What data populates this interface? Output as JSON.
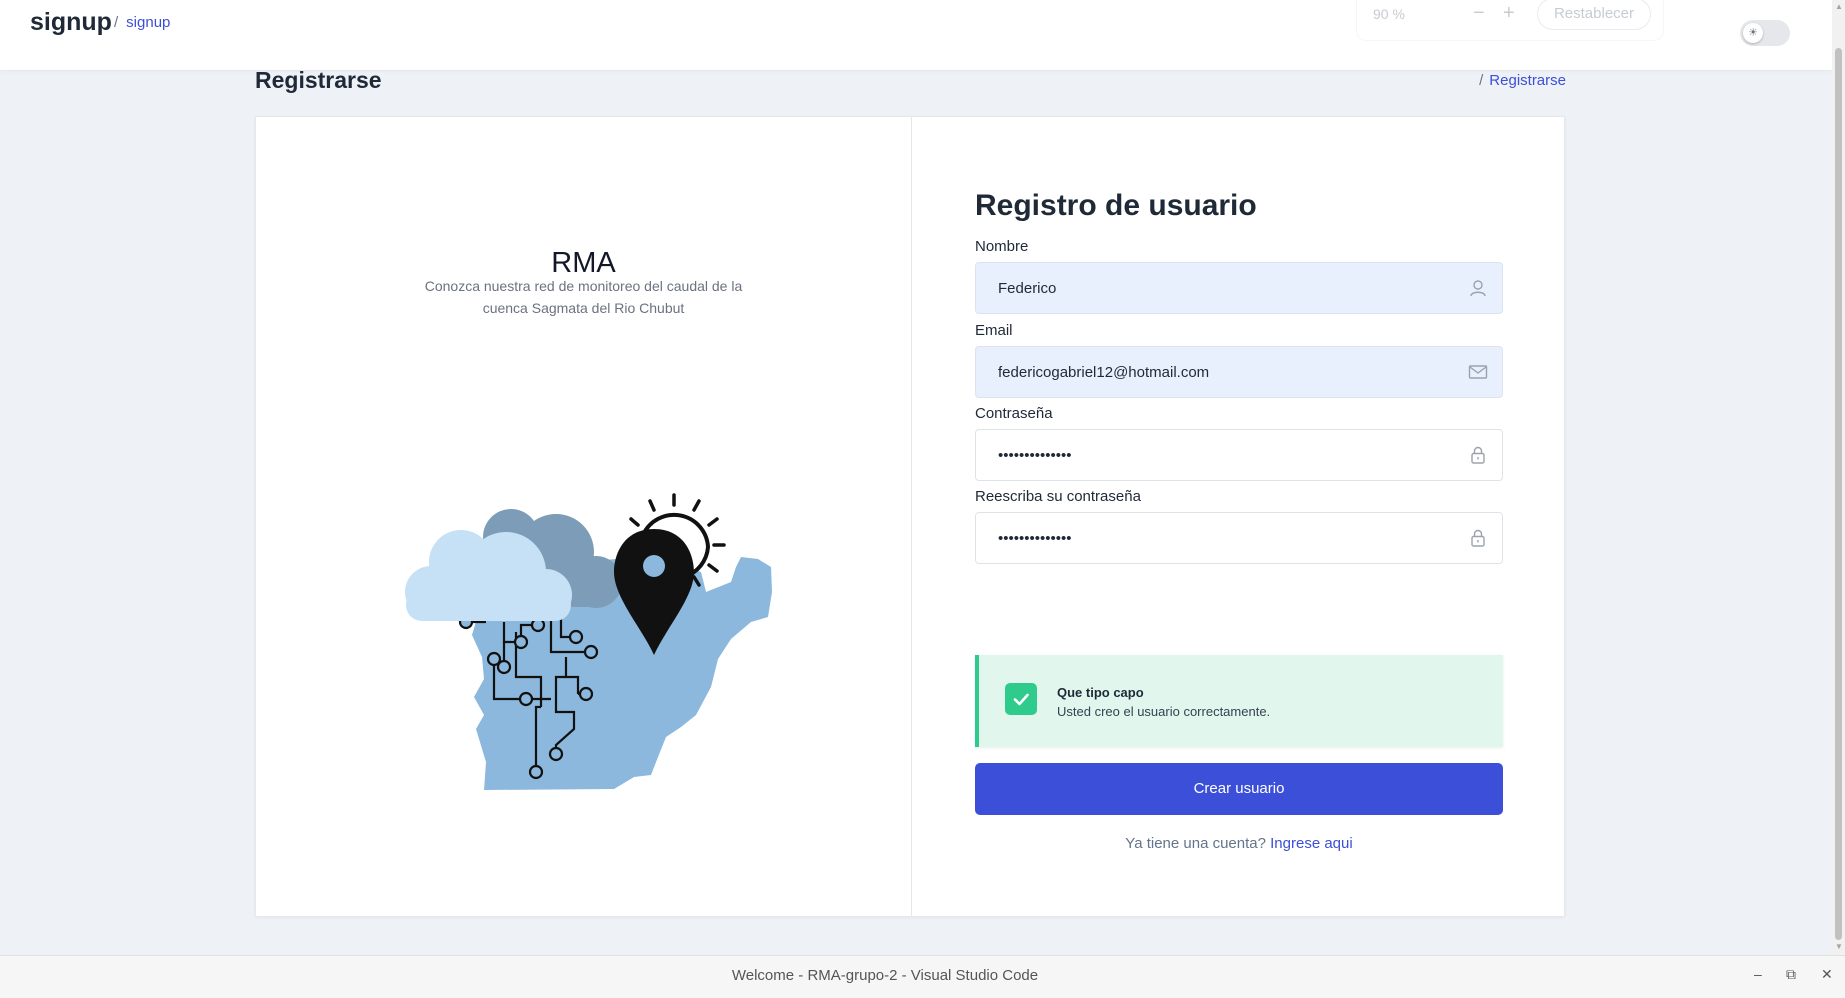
{
  "topbar": {
    "title": "signup",
    "breadcrumb_sep": "/",
    "breadcrumb": "signup",
    "zoom_percent": "90 %",
    "zoom_minus": "−",
    "zoom_plus": "+",
    "zoom_reset": "Restablecer",
    "theme_toggle_icon": "sun-icon"
  },
  "page": {
    "title": "Registrarse",
    "breadcrumb_sep": "/",
    "breadcrumb": "Registrarse"
  },
  "brand": {
    "name": "RMA",
    "description": "Conozca nuestra red de monitoreo del caudal de la cuenca Sagmata del Rio Chubut"
  },
  "form": {
    "title": "Registro de usuario",
    "fields": [
      {
        "label": "Nombre",
        "value": "Federico",
        "icon": "user-icon"
      },
      {
        "label": "Email",
        "value": "federicogabriel12@hotmail.com",
        "icon": "mail-icon"
      },
      {
        "label": "Contraseña",
        "value": "••••••••••••••",
        "icon": "lock-icon"
      },
      {
        "label": "Reescriba su contraseña",
        "value": "••••••••••••••",
        "icon": "lock-icon"
      }
    ],
    "alert": {
      "title": "Que tipo capo",
      "message": "Usted creo el usuario correctamente.",
      "icon": "check-icon"
    },
    "submit_label": "Crear usuario",
    "login_prompt": "Ya tiene una cuenta?",
    "login_link": "Ingrese aqui"
  },
  "window": {
    "title": "Welcome - RMA-grupo-2 - Visual Studio Code",
    "minimize": "–",
    "restore": "⧉",
    "close": "✕"
  },
  "colors": {
    "accent": "#3b4fd8",
    "success": "#2fcb8d",
    "map": "#8bb8dc"
  }
}
